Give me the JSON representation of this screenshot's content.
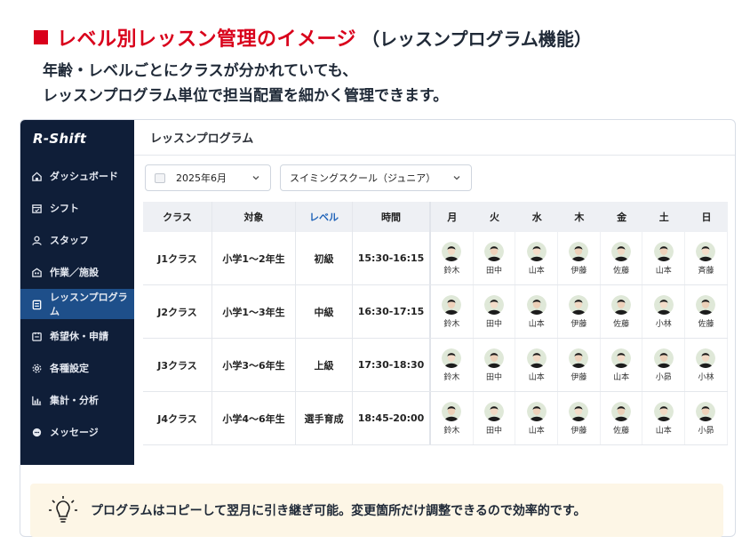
{
  "heading": {
    "title": "レベル別レッスン管理のイメージ",
    "subtitle": "（レッスンプログラム機能）"
  },
  "description": [
    "年齢・レベルごとにクラスが分かれていても、",
    "レッスンプログラム単位で担当配置を細かく管理できます。"
  ],
  "app": {
    "logo": "R-Shift",
    "colors": {
      "sidebar": "#0f1e38",
      "active": "#1e4f8a",
      "accent": "#d9001b"
    },
    "sidebar": [
      {
        "label": "ダッシュボード",
        "icon": "home-icon"
      },
      {
        "label": "シフト",
        "icon": "calendar-icon"
      },
      {
        "label": "スタッフ",
        "icon": "person-icon"
      },
      {
        "label": "作業／施設",
        "icon": "building-icon"
      },
      {
        "label": "レッスンプログラム",
        "icon": "clipboard-icon",
        "active": true
      },
      {
        "label": "希望休・申請",
        "icon": "request-icon"
      },
      {
        "label": "各種設定",
        "icon": "gear-icon"
      },
      {
        "label": "集計・分析",
        "icon": "chart-icon"
      },
      {
        "label": "メッセージ",
        "icon": "message-icon"
      }
    ],
    "main_title": "レッスンプログラム",
    "filters": {
      "month": "2025年6月",
      "program": "スイミングスクール（ジュニア）"
    },
    "table": {
      "headers": [
        "クラス",
        "対象",
        "レベル",
        "時間"
      ],
      "days": [
        "月",
        "火",
        "水",
        "木",
        "金",
        "土",
        "日"
      ],
      "rows": [
        {
          "class": "J1クラス",
          "target": "小学1〜2年生",
          "level": "初級",
          "time": "15:30-16:15",
          "staff": [
            "鈴木",
            "田中",
            "山本",
            "伊藤",
            "佐藤",
            "山本",
            "斉藤"
          ]
        },
        {
          "class": "J2クラス",
          "target": "小学1〜3年生",
          "level": "中級",
          "time": "16:30-17:15",
          "staff": [
            "鈴木",
            "田中",
            "山本",
            "伊藤",
            "佐藤",
            "小林",
            "佐藤"
          ]
        },
        {
          "class": "J3クラス",
          "target": "小学3〜6年生",
          "level": "上級",
          "time": "17:30-18:30",
          "staff": [
            "鈴木",
            "田中",
            "山本",
            "伊藤",
            "山本",
            "小昴",
            "小林"
          ]
        },
        {
          "class": "J4クラス",
          "target": "小学4〜6年生",
          "level": "選手育成",
          "time": "18:45-20:00",
          "staff": [
            "鈴木",
            "田中",
            "山本",
            "伊藤",
            "佐藤",
            "山本",
            "小昴"
          ]
        }
      ]
    }
  },
  "tip": {
    "icon": "lightbulb-icon",
    "text": "プログラムはコピーして翌月に引き継ぎ可能。変更箇所だけ調整できるので効率的です。"
  }
}
